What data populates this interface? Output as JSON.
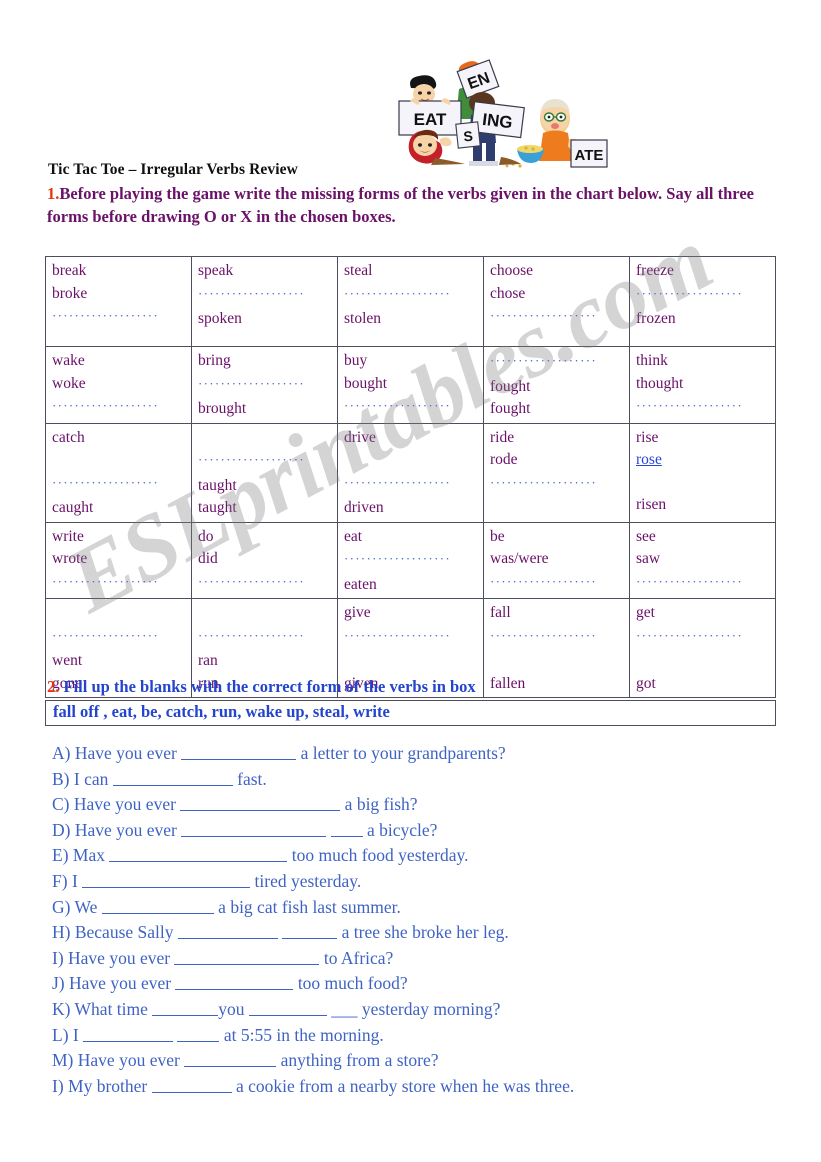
{
  "document": {
    "title": "Tic Tac Toe – Irregular Verbs Review",
    "watermark": "ESLprintables.com"
  },
  "clipart": {
    "name": "kids-holding-verb-signs",
    "signs": [
      "EAT",
      "S",
      "EN",
      "ING",
      "ATE"
    ]
  },
  "section1": {
    "number": "1.",
    "text": "Before playing the game write the missing forms of the verbs given in the chart below. Say all three forms before drawing O or X in the chosen boxes.",
    "number_color": "#e8330d",
    "text_color": "#6a1168"
  },
  "verb_table": {
    "dots_short": "···················",
    "rows": [
      [
        {
          "l1": "break",
          "l2": "broke",
          "l3": "dots"
        },
        {
          "l1": "speak",
          "l2": "dots",
          "l3": "spoken"
        },
        {
          "l1": "steal",
          "l2": "dots",
          "l3": "stolen"
        },
        {
          "l1": "choose",
          "l2": "chose",
          "l3": "dots"
        },
        {
          "l1": "freeze",
          "l2": "dots",
          "l3": "frozen"
        }
      ],
      [
        {
          "l1": "wake",
          "l2": "woke",
          "l3": "dots"
        },
        {
          "l1": "bring",
          "l2": "dots",
          "l3": "brought"
        },
        {
          "l1": "buy",
          "l2": "bought",
          "l3": "dots"
        },
        {
          "l1": "dots",
          "l2": "fought",
          "l3": "fought"
        },
        {
          "l1": "think",
          "l2": "thought",
          "l3": "dots"
        }
      ],
      [
        {
          "l1": "catch",
          "l2": "",
          "l3": "dots",
          "l4": "caught"
        },
        {
          "l1": "",
          "l2": "dots",
          "l3": "taught",
          "l4": "taught"
        },
        {
          "l1": "drive",
          "l2": "",
          "l3": "dots",
          "l4": "driven"
        },
        {
          "l1": "ride",
          "l2": "rode",
          "l3": "dots",
          "l4": ""
        },
        {
          "l1": "rise",
          "l2": "rose-link",
          "l3": "",
          "l4": "risen"
        }
      ],
      [
        {
          "l1": "write",
          "l2": "wrote",
          "l3": "dots"
        },
        {
          "l1": "do",
          "l2": "did",
          "l3": "dots"
        },
        {
          "l1": "eat",
          "l2": "dots",
          "l3": "eaten"
        },
        {
          "l1": "be",
          "l2": "was/were",
          "l3": "dots"
        },
        {
          "l1": "see",
          "l2": "saw",
          "l3": "dots"
        }
      ],
      [
        {
          "l1": "",
          "l2": "dots",
          "l3": "went",
          "l4": "gone"
        },
        {
          "l1": "",
          "l2": "dots",
          "l3": "ran",
          "l4": "run"
        },
        {
          "l1": "give",
          "l2": "dots",
          "l3": "",
          "l4": "given"
        },
        {
          "l1": "fall",
          "l2": "dots",
          "l3": "",
          "l4": "fallen"
        },
        {
          "l1": "get",
          "l2": "dots",
          "l3": "",
          "l4": "got"
        }
      ]
    ],
    "link_word": "rose"
  },
  "section2": {
    "number": "2.",
    "text": "Fill up the blanks with the correct form of the verbs in box",
    "word_box": "fall off , eat, be, catch, run, wake up, steal, write",
    "color": "#2344cc",
    "number_color": "#e8330d"
  },
  "questions": [
    {
      "label": "A)",
      "before": "Have you ever ",
      "blank1": 115,
      "mid": "",
      "blank2": 0,
      "after": " a letter to your grandparents?"
    },
    {
      "label": "B)",
      "before": "I can ",
      "blank1": 120,
      "mid": "",
      "blank2": 0,
      "after": " fast."
    },
    {
      "label": "C)",
      "before": "Have you ever ",
      "blank1": 160,
      "mid": "",
      "blank2": 0,
      "after": "  a big fish?"
    },
    {
      "label": "D)",
      "before": "Have you ever ",
      "blank1": 145,
      "mid": " ",
      "blank2": 32,
      "after": " a bicycle?"
    },
    {
      "label": "E)",
      "before": "Max ",
      "blank1": 178,
      "mid": "",
      "blank2": 0,
      "after": " too much food yesterday."
    },
    {
      "label": "F)",
      "before": "I ",
      "blank1": 168,
      "mid": "",
      "blank2": 0,
      "after": " tired yesterday."
    },
    {
      "label": "G)",
      "before": "We ",
      "blank1": 112,
      "mid": "",
      "blank2": 0,
      "after": " a big cat fish last summer."
    },
    {
      "label": "H)",
      "before": "Because Sally ",
      "blank1": 100,
      "mid": " ",
      "blank2": 55,
      "after": " a tree she broke her leg."
    },
    {
      "label": "I)",
      "before": "Have you ever ",
      "blank1": 145,
      "mid": "",
      "blank2": 0,
      "after": " to Africa?"
    },
    {
      "label": "J)",
      "before": "Have you ever ",
      "blank1": 118,
      "mid": "",
      "blank2": 0,
      "after": " too much food?"
    },
    {
      "label": "K)",
      "before": "What time ",
      "blank1": 66,
      "mid": "you ",
      "blank2": 78,
      "after": " ___ yesterday morning?"
    },
    {
      "label": "L)",
      "before": "I ",
      "blank1": 90,
      "mid": " ",
      "blank2": 42,
      "after": " at 5:55 in the morning."
    },
    {
      "label": "M)",
      "before": "Have you ever ",
      "blank1": 92,
      "mid": "",
      "blank2": 0,
      "after": " anything from a store?"
    },
    {
      "label": "I)",
      "before": "My brother ",
      "blank1": 80,
      "mid": "",
      "blank2": 0,
      "after": " a cookie from a nearby store when he was three."
    }
  ]
}
